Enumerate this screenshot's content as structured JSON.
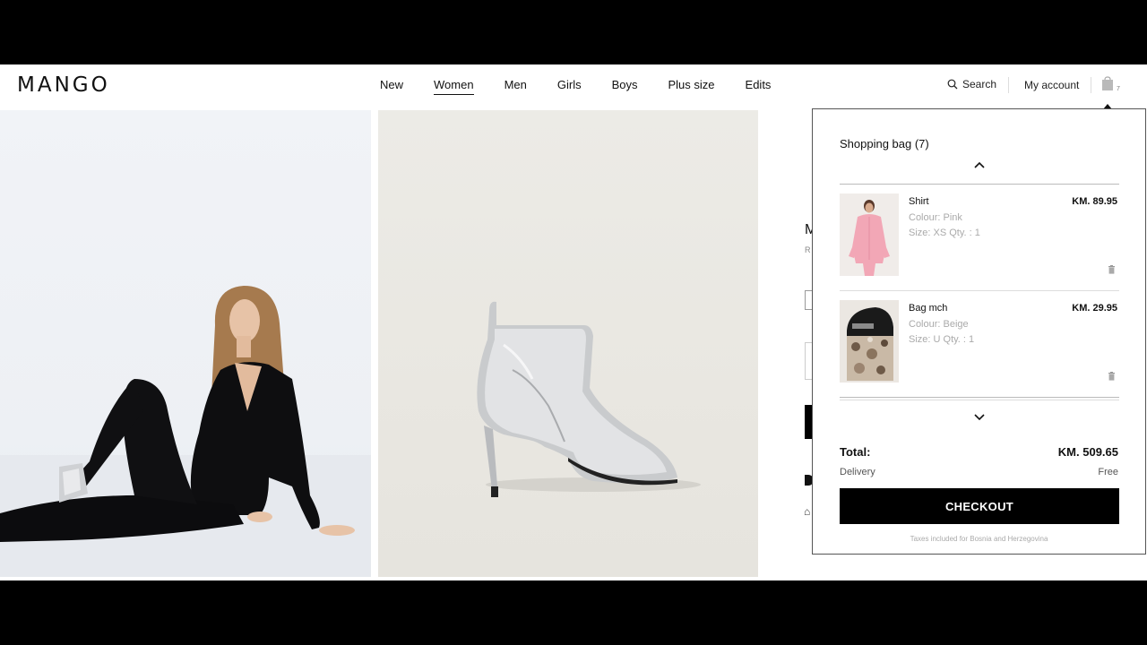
{
  "header": {
    "logo": "MANGO",
    "nav": [
      "New",
      "Women",
      "Men",
      "Girls",
      "Boys",
      "Plus size",
      "Edits"
    ],
    "active_nav": "Women",
    "search_label": "Search",
    "account_label": "My account",
    "bag_count": "7"
  },
  "product_peek": {
    "title_fragment": "M",
    "sub_fragment": "R"
  },
  "bag": {
    "title": "Shopping bag (7)",
    "items": [
      {
        "name": "Shirt",
        "colour": "Colour: Pink",
        "size": "Size: XS  Qty. : 1",
        "price": "KM. 89.95"
      },
      {
        "name": "Bag mch",
        "colour": "Colour: Beige",
        "size": "Size: U  Qty. : 1",
        "price": "KM. 29.95"
      }
    ],
    "total_label": "Total:",
    "total_value": "KM. 509.65",
    "delivery_label": "Delivery",
    "delivery_value": "Free",
    "checkout_label": "CHECKOUT",
    "taxes_note": "Taxes included for Bosnia and Herzegovina"
  },
  "colors": {
    "brand": "#111111",
    "button": "#000000",
    "muted": "#aaaaaa"
  }
}
